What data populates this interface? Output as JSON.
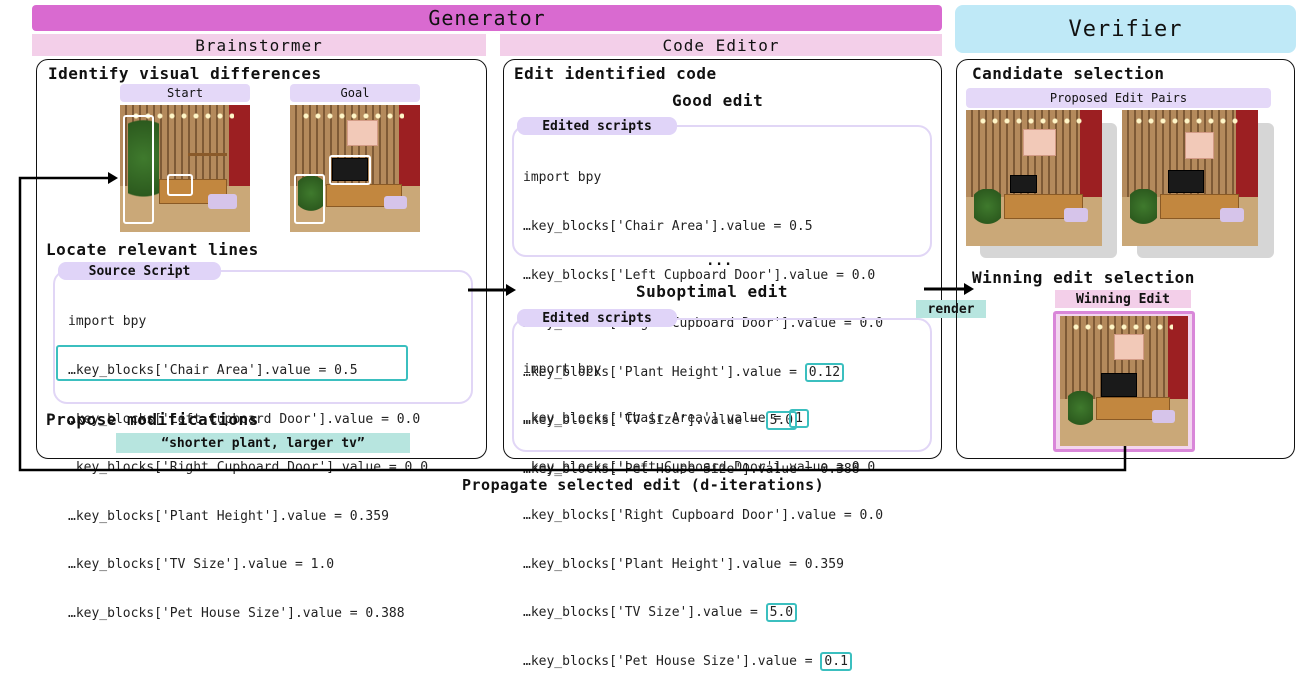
{
  "generator": {
    "title": "Generator"
  },
  "verifier": {
    "title": "Verifier"
  },
  "brainstormer": {
    "title": "Brainstormer",
    "step1": "Identify visual differences",
    "start_label": "Start",
    "goal_label": "Goal",
    "step2": "Locate relevant lines",
    "source_label": "Source Script",
    "source_lines": [
      "import bpy",
      "…key_blocks['Chair Area'].value = 0.5",
      "…key_blocks['Left Cupboard Door'].value = 0.0",
      "…key_blocks['Right Cupboard Door'].value = 0.0",
      "…key_blocks['Plant Height'].value = 0.359",
      "…key_blocks['TV Size'].value = 1.0",
      "…key_blocks['Pet House Size'].value = 0.388"
    ],
    "step3": "Propose modifications",
    "proposal": "“shorter plant, larger tv”"
  },
  "code_editor": {
    "title": "Code Editor",
    "step": "Edit identified code",
    "good_title": "Good edit",
    "edited_label": "Edited scripts",
    "good_lines": [
      "import bpy",
      "…key_blocks['Chair Area'].value = 0.5",
      "…key_blocks['Left Cupboard Door'].value = 0.0",
      "…key_blocks['Right Cupboard Door'].value = 0.0",
      "…key_blocks['Plant Height'].value = ",
      "…key_blocks['TV Size'].value = ",
      "…key_blocks['Pet House Size'].value = 0.388"
    ],
    "good_hl": [
      "0.12",
      "5.0"
    ],
    "ellipsis": "...",
    "sub_title": "Suboptimal edit",
    "sub_lines": [
      "import bpy",
      "…key_blocks['Chair Area'].value = ",
      "…key_blocks['Left Cupboard Door'].value = 0.0",
      "…key_blocks['Right Cupboard Door'].value = 0.0",
      "…key_blocks['Plant Height'].value = 0.359",
      "…key_blocks['TV Size'].value = ",
      "…key_blocks['Pet House Size'].value = "
    ],
    "sub_hl": [
      "1",
      "5.0",
      "0.1"
    ]
  },
  "verifier_panel": {
    "step1": "Candidate selection",
    "pairs_label": "Proposed Edit Pairs",
    "step2": "Winning edit selection",
    "winning_label": "Winning Edit",
    "render_label": "render"
  },
  "footer": {
    "caption": "Propagate selected edit (d-iterations)"
  },
  "colors": {
    "generator": "#d96ad0",
    "subbanner": "#f3cfe9",
    "verifier": "#bfe9f7",
    "highlight": "#3bbfbf",
    "proposal": "#b7e5df",
    "winning": "#d987d9"
  }
}
